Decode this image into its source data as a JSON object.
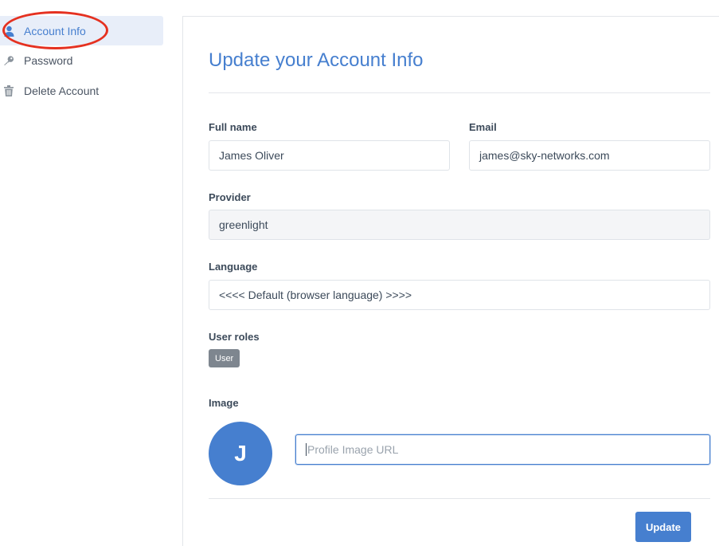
{
  "sidebar": {
    "items": [
      {
        "label": "Account Info",
        "icon": "user-icon",
        "active": true
      },
      {
        "label": "Password",
        "icon": "key-icon",
        "active": false
      },
      {
        "label": "Delete Account",
        "icon": "trash-icon",
        "active": false
      }
    ]
  },
  "main": {
    "title": "Update your Account Info",
    "full_name": {
      "label": "Full name",
      "value": "James Oliver"
    },
    "email": {
      "label": "Email",
      "value": "james@sky-networks.com"
    },
    "provider": {
      "label": "Provider",
      "value": "greenlight"
    },
    "language": {
      "label": "Language",
      "value": "<<<< Default (browser language) >>>>"
    },
    "user_roles": {
      "label": "User roles",
      "badge": "User"
    },
    "image": {
      "label": "Image",
      "avatar_initial": "J",
      "placeholder": "Profile Image URL"
    },
    "update_label": "Update"
  },
  "colors": {
    "accent": "#467fcf",
    "annotation_ring": "#e53120",
    "badge": "#7e868f"
  }
}
